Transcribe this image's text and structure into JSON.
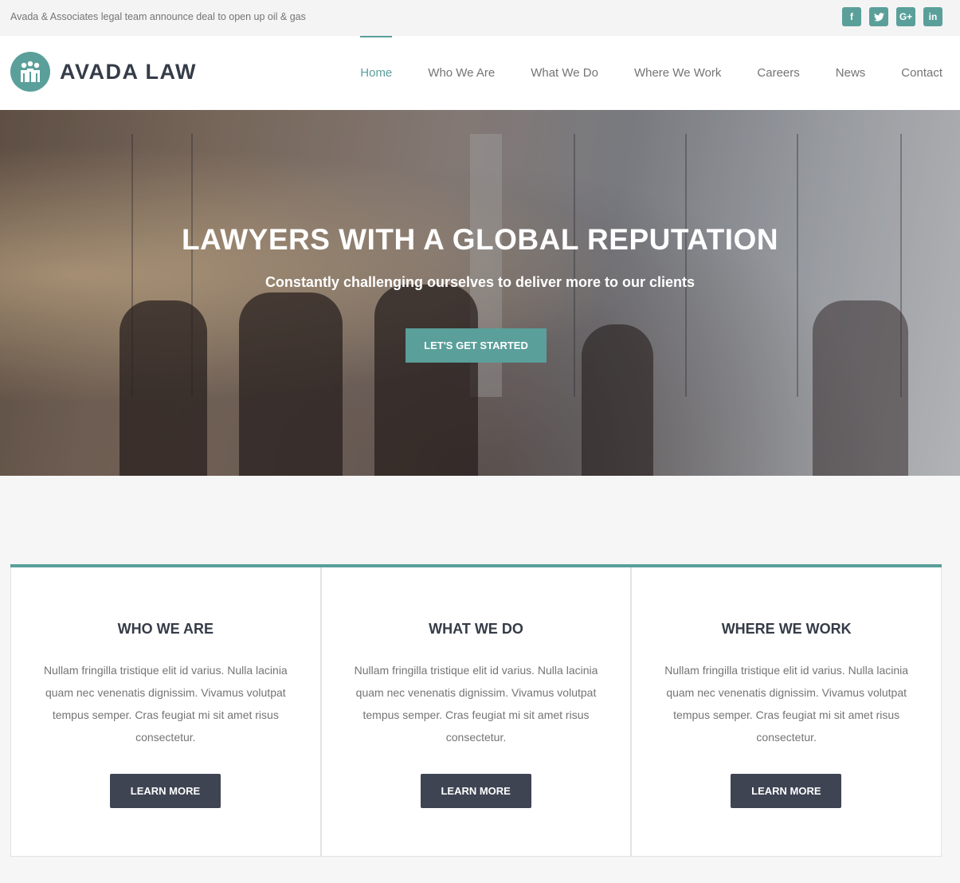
{
  "topbar": {
    "announcement": "Avada & Associates legal team announce deal to open up oil & gas",
    "social": [
      {
        "icon": "facebook-icon",
        "glyph": "f"
      },
      {
        "icon": "twitter-icon",
        "glyph": "t"
      },
      {
        "icon": "google-plus-icon",
        "glyph": "G+"
      },
      {
        "icon": "linkedin-icon",
        "glyph": "in"
      }
    ]
  },
  "header": {
    "logo_text": "AVADA LAW",
    "nav": [
      "Home",
      "Who We Are",
      "What We Do",
      "Where We Work",
      "Careers",
      "News",
      "Contact"
    ],
    "active": "Home"
  },
  "hero": {
    "title": "LAWYERS WITH A GLOBAL REPUTATION",
    "subtitle": "Constantly challenging ourselves to deliver more to our clients",
    "cta": "LET'S GET STARTED"
  },
  "cards": [
    {
      "title": "WHO WE ARE",
      "text": "Nullam fringilla tristique elit id varius. Nulla lacinia quam nec venenatis dignissim. Vivamus volutpat tempus semper. Cras feugiat mi sit amet risus consectetur.",
      "button": "LEARN MORE"
    },
    {
      "title": "WHAT WE DO",
      "text": "Nullam fringilla tristique elit id varius. Nulla lacinia quam nec venenatis dignissim. Vivamus volutpat tempus semper. Cras feugiat mi sit amet risus consectetur.",
      "button": "LEARN MORE"
    },
    {
      "title": "WHERE WE WORK",
      "text": "Nullam fringilla tristique elit id varius. Nulla lacinia quam nec venenatis dignissim. Vivamus volutpat tempus semper. Cras feugiat mi sit amet risus consectetur.",
      "button": "LEARN MORE"
    }
  ],
  "colors": {
    "accent": "#5a9f9a",
    "dark": "#3f4453",
    "heading": "#353c48",
    "text": "#747474"
  }
}
